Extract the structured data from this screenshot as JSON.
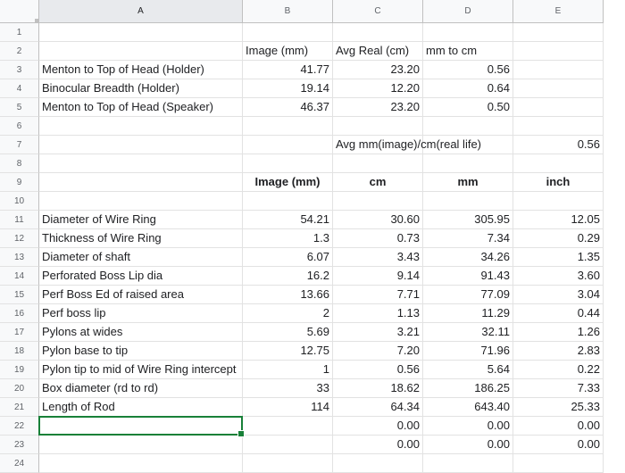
{
  "columns": [
    "A",
    "B",
    "C",
    "D",
    "E"
  ],
  "selected_cell": "A22",
  "rows": [
    {
      "n": "1",
      "cells": [
        "",
        "",
        "",
        "",
        ""
      ]
    },
    {
      "n": "2",
      "cells": [
        "",
        "Image (mm)",
        "Avg Real (cm)",
        "mm to cm",
        ""
      ]
    },
    {
      "n": "3",
      "cells": [
        "Menton to Top of Head (Holder)",
        "41.77",
        "23.20",
        "0.56",
        ""
      ]
    },
    {
      "n": "4",
      "cells": [
        "Binocular Breadth (Holder)",
        "19.14",
        "12.20",
        "0.64",
        ""
      ]
    },
    {
      "n": "5",
      "cells": [
        "Menton to Top of Head (Speaker)",
        "46.37",
        "23.20",
        "0.50",
        ""
      ]
    },
    {
      "n": "6",
      "cells": [
        "",
        "",
        "",
        "",
        ""
      ]
    },
    {
      "n": "7",
      "cells": [
        "",
        "",
        "Avg mm(image)/cm(real life)",
        "",
        "0.56"
      ]
    },
    {
      "n": "8",
      "cells": [
        "",
        "",
        "",
        "",
        ""
      ]
    },
    {
      "n": "9",
      "cells": [
        "",
        "Image (mm)",
        "cm",
        "mm",
        "inch"
      ]
    },
    {
      "n": "10",
      "cells": [
        "",
        "",
        "",
        "",
        ""
      ]
    },
    {
      "n": "11",
      "cells": [
        "Diameter of Wire Ring",
        "54.21",
        "30.60",
        "305.95",
        "12.05"
      ]
    },
    {
      "n": "12",
      "cells": [
        "Thickness of Wire Ring",
        "1.3",
        "0.73",
        "7.34",
        "0.29"
      ]
    },
    {
      "n": "13",
      "cells": [
        "Diameter of shaft",
        "6.07",
        "3.43",
        "34.26",
        "1.35"
      ]
    },
    {
      "n": "14",
      "cells": [
        "Perforated Boss Lip dia",
        "16.2",
        "9.14",
        "91.43",
        "3.60"
      ]
    },
    {
      "n": "15",
      "cells": [
        "Perf Boss Ed of raised area",
        "13.66",
        "7.71",
        "77.09",
        "3.04"
      ]
    },
    {
      "n": "16",
      "cells": [
        "Perf boss lip",
        "2",
        "1.13",
        "11.29",
        "0.44"
      ]
    },
    {
      "n": "17",
      "cells": [
        "Pylons at wides",
        "5.69",
        "3.21",
        "32.11",
        "1.26"
      ]
    },
    {
      "n": "18",
      "cells": [
        "Pylon base to tip",
        "12.75",
        "7.20",
        "71.96",
        "2.83"
      ]
    },
    {
      "n": "19",
      "cells": [
        "Pylon tip to mid of Wire Ring intercept",
        "1",
        "0.56",
        "5.64",
        "0.22"
      ]
    },
    {
      "n": "20",
      "cells": [
        "Box diameter (rd to rd)",
        "33",
        "18.62",
        "186.25",
        "7.33"
      ]
    },
    {
      "n": "21",
      "cells": [
        "Length of Rod",
        "114",
        "64.34",
        "643.40",
        "25.33"
      ]
    },
    {
      "n": "22",
      "cells": [
        "",
        "",
        "0.00",
        "0.00",
        "0.00"
      ]
    },
    {
      "n": "23",
      "cells": [
        "",
        "",
        "0.00",
        "0.00",
        "0.00"
      ]
    },
    {
      "n": "24",
      "cells": [
        "",
        "",
        "",
        "",
        ""
      ]
    }
  ]
}
